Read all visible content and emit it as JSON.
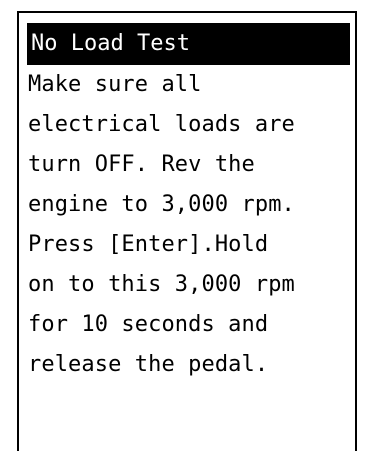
{
  "screen": {
    "title": "No Load Test",
    "lines": [
      "Make sure all",
      "electrical loads are",
      "turn OFF. Rev the",
      "engine to 3,000 rpm.",
      "Press [Enter].Hold",
      "on to this 3,000 rpm",
      "for 10 seconds and",
      "release the pedal."
    ]
  },
  "colors": {
    "title_background": "#000000",
    "title_text": "#ffffff",
    "body_text": "#000000",
    "screen_background": "#ffffff"
  }
}
